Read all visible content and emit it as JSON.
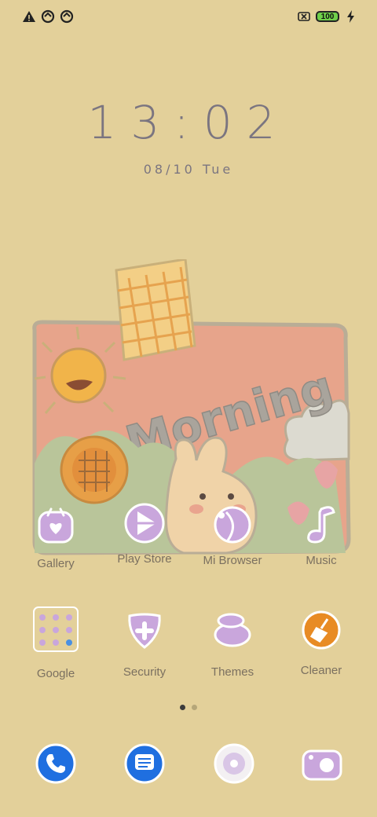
{
  "status_bar": {
    "left_icons": [
      "warning-icon",
      "data-saver-icon",
      "data-saver-icon"
    ],
    "battery_level": "100",
    "right_icons": [
      "sim-off-icon",
      "battery-icon",
      "charging-icon"
    ]
  },
  "lockscreen": {
    "time": "13:02",
    "date": "08/10 Tue"
  },
  "widget": {
    "text": "Morning"
  },
  "home_row_1": [
    {
      "label": "Gallery"
    },
    {
      "label": "Play Store"
    },
    {
      "label": "Mi Browser"
    },
    {
      "label": "Music"
    }
  ],
  "home_row_2": [
    {
      "label": "Google"
    },
    {
      "label": "Security"
    },
    {
      "label": "Themes"
    },
    {
      "label": "Cleaner"
    }
  ],
  "page_indicator": {
    "pages": 2,
    "current": 1
  },
  "dock": [
    {
      "name": "phone-icon"
    },
    {
      "name": "messages-icon"
    },
    {
      "name": "browser-icon"
    },
    {
      "name": "camera-icon"
    }
  ],
  "colors": {
    "background": "#e3d09a",
    "icon_purple": "#c9a6dc",
    "accent_orange": "#e88b24",
    "dock_blue": "#1f6fe0"
  }
}
